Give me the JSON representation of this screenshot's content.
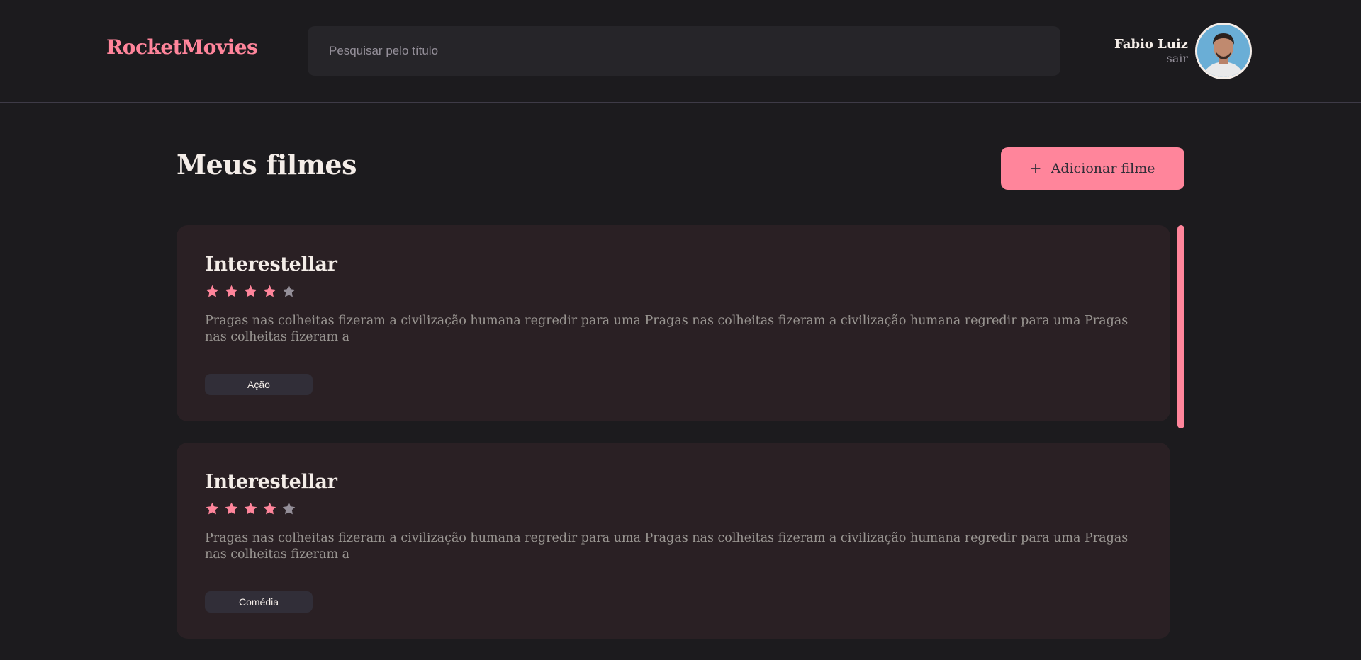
{
  "header": {
    "logo": "RocketMovies",
    "search_placeholder": "Pesquisar pelo título",
    "search_value": "",
    "user_name": "Fabio Luiz",
    "logout_label": "sair"
  },
  "main": {
    "title": "Meus filmes",
    "add_button_label": "Adicionar filme",
    "add_button_icon": "plus-icon",
    "movies": [
      {
        "title": "Interestellar",
        "rating": 4,
        "max_rating": 5,
        "description": "Pragas nas colheitas fizeram a civilização humana regredir para uma Pragas nas colheitas fizeram a civilização humana regredir para uma Pragas nas colheitas fizeram a",
        "tags": [
          "Ação"
        ]
      },
      {
        "title": "Interestellar",
        "rating": 4,
        "max_rating": 5,
        "description": "Pragas nas colheitas fizeram a civilização humana regredir para uma Pragas nas colheitas fizeram a civilização humana regredir para uma Pragas nas colheitas fizeram a",
        "tags": [
          "Comédia"
        ]
      }
    ]
  },
  "colors": {
    "accent": "#ff859b",
    "background": "#1c1b1e",
    "card": "#2a2024",
    "star_filled": "#ff859b",
    "star_empty": "#948f99",
    "text": "#f4ede8",
    "muted": "#999591",
    "tag_bg": "#312e38"
  }
}
